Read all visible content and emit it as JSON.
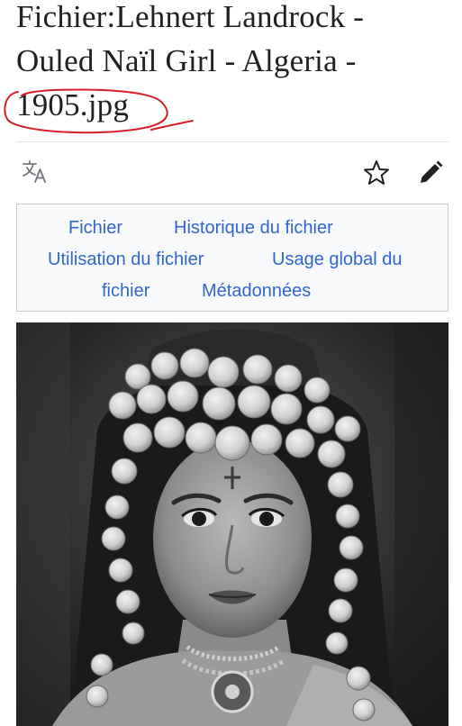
{
  "title": {
    "line1": "Fichier:Lehnert Landrock -",
    "line2": "Ouled Naïl Girl - Algeria -",
    "line3": "1905.jpg"
  },
  "header_icons": {
    "translate": "translate-icon",
    "watch": "star-icon",
    "edit": "pencil-icon"
  },
  "tabs": {
    "file": "Fichier",
    "history": "Historique du fichier",
    "usage": "Utilisation du fichier",
    "global_usage_line1": "Usage global du",
    "global_usage_line2": "fichier",
    "metadata": "Métadonnées"
  },
  "colors": {
    "link": "#3366cc",
    "annotation": "#d61f2b",
    "text": "#202122"
  }
}
